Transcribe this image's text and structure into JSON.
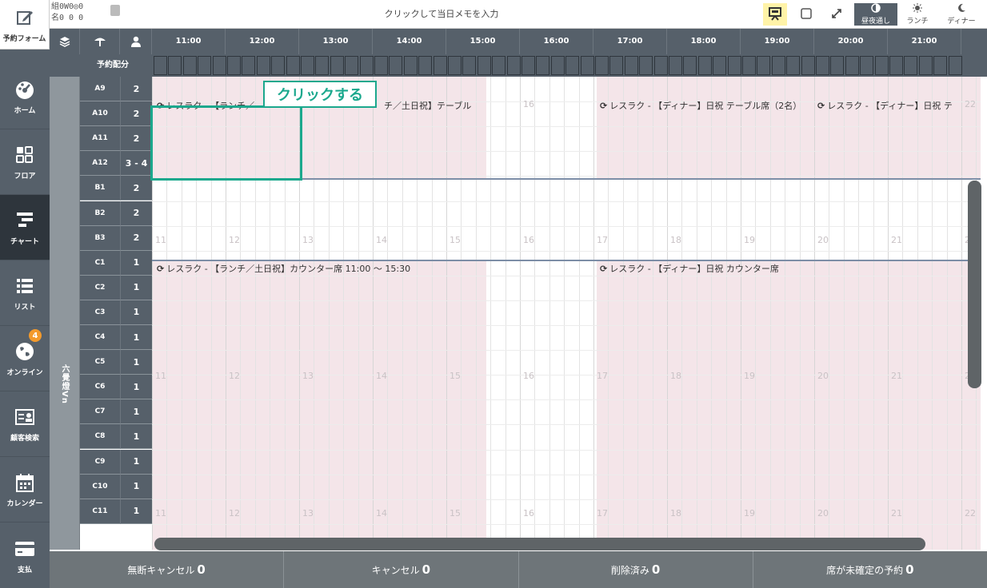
{
  "nav": {
    "items": [
      {
        "label": "予約フォーム",
        "icon": "edit-icon"
      },
      {
        "label": "ホーム",
        "icon": "dashboard-icon"
      },
      {
        "label": "フロア",
        "icon": "floor-icon"
      },
      {
        "label": "チャート",
        "icon": "chart-icon"
      },
      {
        "label": "リスト",
        "icon": "list-icon"
      },
      {
        "label": "オンライン",
        "icon": "globe-icon",
        "badge": "4"
      },
      {
        "label": "顧客検索",
        "icon": "customer-card-icon"
      },
      {
        "label": "カレンダー",
        "icon": "calendar-icon"
      },
      {
        "label": "支払",
        "icon": "credit-card-icon"
      }
    ]
  },
  "topbar": {
    "counts_line1": "組0W0◎0",
    "counts_line2": "名0  0  0",
    "memo_placeholder": "クリックして当日メモを入力",
    "mode_all": "昼夜通し",
    "mode_lunch": "ランチ",
    "mode_dinner": "ディナー"
  },
  "schedule": {
    "alloc_label": "予約配分",
    "hours": [
      "11:00",
      "12:00",
      "13:00",
      "14:00",
      "15:00",
      "16:00",
      "17:00",
      "18:00",
      "19:00",
      "20:00",
      "21:00"
    ],
    "group_name": "六覺燈Vn",
    "tables": [
      {
        "name": "A9",
        "cap": "2"
      },
      {
        "name": "A10",
        "cap": "2"
      },
      {
        "name": "A11",
        "cap": "2"
      },
      {
        "name": "A12",
        "cap": "3 - 4"
      },
      {
        "name": "B1",
        "cap": "2"
      },
      {
        "name": "B2",
        "cap": "2"
      },
      {
        "name": "B3",
        "cap": "2"
      },
      {
        "name": "C1",
        "cap": "1"
      },
      {
        "name": "C2",
        "cap": "1"
      },
      {
        "name": "C3",
        "cap": "1"
      },
      {
        "name": "C4",
        "cap": "1"
      },
      {
        "name": "C5",
        "cap": "1"
      },
      {
        "name": "C6",
        "cap": "1"
      },
      {
        "name": "C7",
        "cap": "1"
      },
      {
        "name": "C8",
        "cap": "1"
      },
      {
        "name": "C9",
        "cap": "1"
      },
      {
        "name": "C10",
        "cap": "1"
      },
      {
        "name": "C11",
        "cap": "1"
      }
    ],
    "events": {
      "a_lunch_left": "レスラク - 【ランチ／",
      "a_lunch_right": "チ／土日祝】テーブル",
      "a_dinner": "レスラク - 【ディナー】日祝 テーブル席（2名）",
      "a_dinner2": "レスラク - 【ディナー】日祝 テ",
      "c_lunch": "レスラク - 【ランチ／土日祝】カウンター席  11:00 ～ 15:30",
      "c_dinner": "レスラク - 【ディナー】日祝 カウンター席"
    },
    "hour_nums": [
      "11",
      "12",
      "13",
      "14",
      "15",
      "16",
      "17",
      "18",
      "19",
      "20",
      "21",
      "22"
    ]
  },
  "callout": {
    "label": "クリックする"
  },
  "footer": {
    "no_show_label": "無断キャンセル",
    "no_show_count": "0",
    "cancel_label": "キャンセル",
    "cancel_count": "0",
    "deleted_label": "削除済み",
    "deleted_count": "0",
    "unassigned_label": "席が未確定の予約",
    "unassigned_count": "0"
  }
}
